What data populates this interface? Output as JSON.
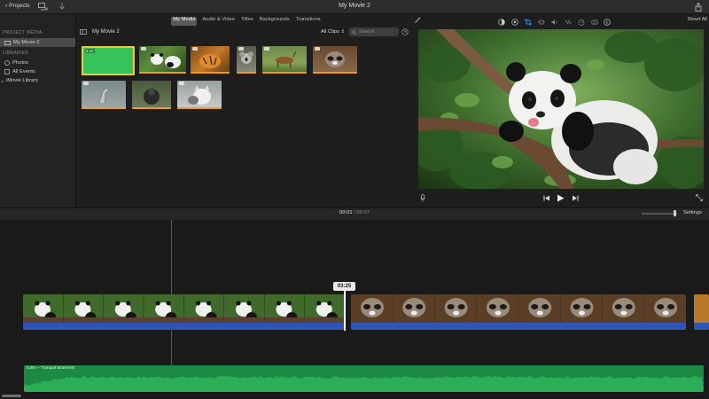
{
  "window": {
    "title": "My Movie 2",
    "projects_label": "Projects"
  },
  "sidebar": {
    "project_media_header": "PROJECT MEDIA",
    "project_item": "My Movie 2",
    "libraries_header": "LIBRARIES",
    "library_items": [
      {
        "label": "Photos",
        "icon": "photos-icon"
      },
      {
        "label": "All Events",
        "icon": "events-icon"
      },
      {
        "label": "iMovie Library",
        "icon": "disclosure-triangle-icon"
      }
    ]
  },
  "media_tabs": [
    "My Media",
    "Audio & Video",
    "Titles",
    "Backgrounds",
    "Transitions"
  ],
  "media_tabs_active": "My Media",
  "browser": {
    "title": "My Movie 2",
    "filter": "All Clips",
    "search_placeholder": "Search",
    "clips": [
      {
        "name": "green-screen-clip",
        "duration_badge": "5.1s",
        "selected": true
      },
      {
        "name": "panda-clip"
      },
      {
        "name": "tiger-clip"
      },
      {
        "name": "koala-clip"
      },
      {
        "name": "antelope-clip"
      },
      {
        "name": "raccoon-clip"
      },
      {
        "name": "heron-clip"
      },
      {
        "name": "gorilla-clip"
      },
      {
        "name": "cat-clip"
      }
    ]
  },
  "viewer": {
    "reset_label": "Reset All"
  },
  "timeline": {
    "current_time": "00:01",
    "total_time": "00:07",
    "settings_label": "Settings",
    "clip_duration": "03:25",
    "music_label": "5.9m – Tranquil Moments"
  },
  "colors": {
    "accent_yellow": "#f4c63b",
    "clip_blue": "#2e55b6",
    "audio_green": "#1d8a44",
    "unused_orange": "#f29a1c"
  }
}
